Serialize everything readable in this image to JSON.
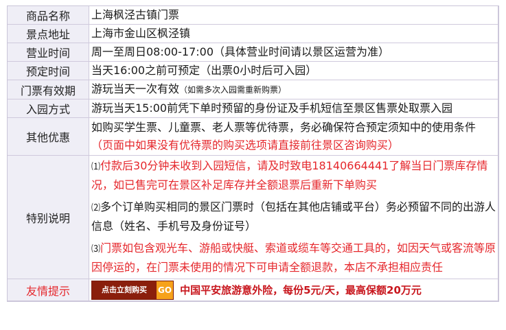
{
  "rows": [
    {
      "label": "商品名称",
      "value": "上海枫泾古镇门票"
    },
    {
      "label": "景点地址",
      "value": "上海市金山区枫泾镇"
    },
    {
      "label": "营业时间",
      "value_main": "周一至周日08:00-17:00",
      "value_note": "（具体营业时间请以景区运营为准）"
    },
    {
      "label": "预定时间",
      "value": "当天16:00之前可预定（出票0小时后可入园）"
    },
    {
      "label": "门票有效期",
      "value_main": "游玩当天一次有效",
      "value_note": "（如需多次入园需重新购票）"
    },
    {
      "label": "入园方式",
      "value": "游玩当天15:00前凭下单时预留的身份证及手机短信至景区售票处取票入园"
    },
    {
      "label": "其他优惠",
      "value_main": "如购买学生票、儿童票、老人票等优待票，务必确保符合预定须知中的使用条件",
      "value_note": "（页面中如果没有优待票的购买选项请直接前往景区咨询购买）"
    }
  ],
  "special": {
    "label": "特别说明",
    "items": [
      {
        "num": "⑴",
        "text": "付款后30分钟未收到入园短信，请及时致电18140664441了解当日门票库存情况，如已售完可在景区补足库存并全额退票后重新下单购买"
      },
      {
        "num": "⑵",
        "text": "多个订单购买相同的景区门票时（包括在其他店铺或平台）务必预留不同的出游人信息（姓名、手机号及身份证号）"
      },
      {
        "num": "⑶",
        "text": "门票如包含观光车、游船或快艇、索道或缆车等交通工具的，如因天气或客流等原因停运的，在门票未使用的情况下可申请全额退款，本店不承担相应责任"
      }
    ]
  },
  "tip": {
    "label": "友情提示",
    "button_label": "点击立刻购买",
    "button_go": "GO",
    "insurance_text": "中国平安旅游意外险，每份5元/天，最高保额20万元"
  }
}
